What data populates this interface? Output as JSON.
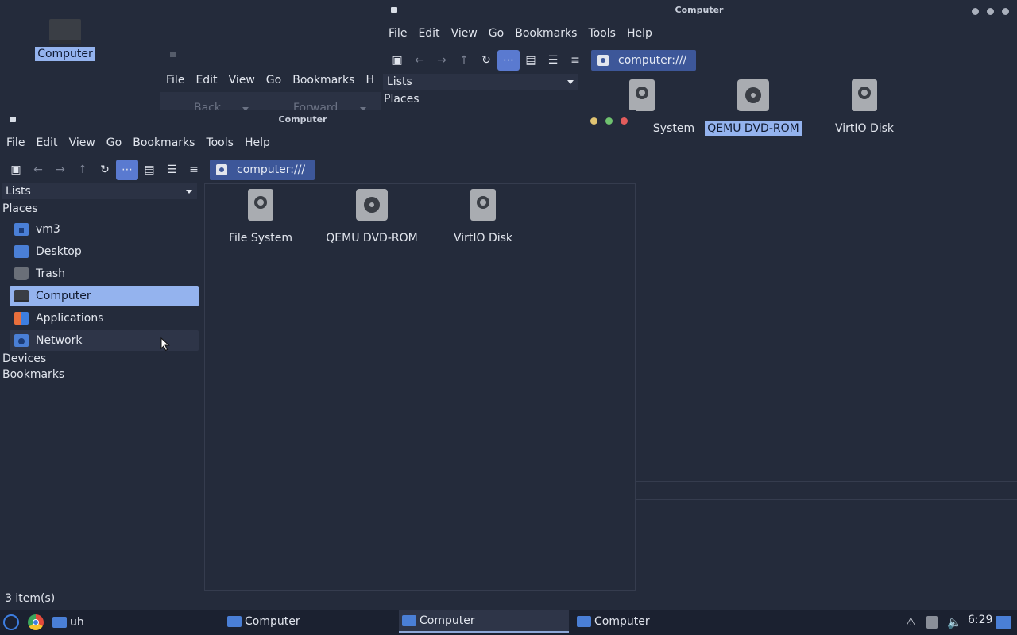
{
  "desktop": {
    "icon_label": "Computer"
  },
  "back_window": {
    "title": "Computer",
    "menu": [
      "File",
      "Edit",
      "View",
      "Go",
      "Bookmarks",
      "Tools",
      "Help"
    ],
    "location": "computer:///",
    "sidebar_combo": "Lists",
    "sidebar_section": "Places",
    "items": [
      "System",
      "QEMU DVD-ROM",
      "VirtIO Disk"
    ]
  },
  "mid_window": {
    "menu": [
      "File",
      "Edit",
      "View",
      "Go",
      "Bookmarks",
      "H"
    ],
    "back": "Back",
    "forward": "Forward"
  },
  "front_window": {
    "title": "Computer",
    "menu": [
      "File",
      "Edit",
      "View",
      "Go",
      "Bookmarks",
      "Tools",
      "Help"
    ],
    "location": "computer:///",
    "sidebar": {
      "combo": "Lists",
      "places_header": "Places",
      "places": [
        {
          "label": "vm3",
          "icon": "home-folder-icon"
        },
        {
          "label": "Desktop",
          "icon": "desktop-folder-icon"
        },
        {
          "label": "Trash",
          "icon": "trash-icon"
        },
        {
          "label": "Computer",
          "icon": "computer-icon"
        },
        {
          "label": "Applications",
          "icon": "applications-icon"
        },
        {
          "label": "Network",
          "icon": "network-icon"
        }
      ],
      "devices_header": "Devices",
      "bookmarks_header": "Bookmarks"
    },
    "items": [
      {
        "label": "File System",
        "icon": "harddisk-icon"
      },
      {
        "label": "QEMU DVD-ROM",
        "icon": "optical-drive-icon"
      },
      {
        "label": "VirtIO Disk",
        "icon": "harddisk-icon"
      }
    ],
    "status": "3 item(s)"
  },
  "taskbar": {
    "launcher_label": "uh",
    "tasks": [
      "Computer",
      "Computer",
      "Computer"
    ],
    "clock": "6:29"
  }
}
